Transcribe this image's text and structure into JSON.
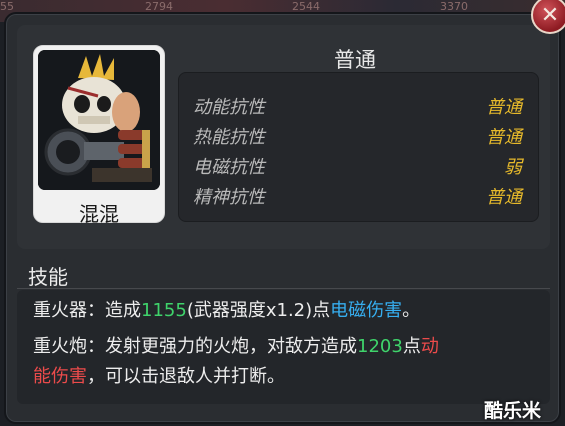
{
  "top_strip": {
    "numbers": [
      "55",
      "2794",
      "2544",
      "3370"
    ]
  },
  "close_button": {
    "label": "✕"
  },
  "character": {
    "name": "混混",
    "portrait_icon": "punk-skull-mask-character"
  },
  "resistance": {
    "type_title": "普通",
    "rows": [
      {
        "label": "动能抗性",
        "value": "普通"
      },
      {
        "label": "热能抗性",
        "value": "普通"
      },
      {
        "label": "电磁抗性",
        "value": "弱"
      },
      {
        "label": "精神抗性",
        "value": "普通"
      }
    ]
  },
  "skills": {
    "title": "技能",
    "items": [
      {
        "name": "重火器",
        "sep": "：",
        "text1": "造成",
        "number": "1155",
        "text2": "(武器强度x1.2)点",
        "damage": "电磁伤害",
        "text3": "。"
      },
      {
        "name": "重火炮",
        "sep": "：",
        "text1": "发射更强力的火炮，对敌方造成",
        "number": "1203",
        "text2": "点",
        "damage_line1": "动",
        "damage_line2": "能伤害",
        "text3": "，可以击退敌人并打断。"
      }
    ]
  },
  "watermark": "酷乐米",
  "colors": {
    "value_gold": "#e6b92b",
    "number_green": "#3fd36b",
    "electro_blue": "#36aef0",
    "kinetic_red": "#ec4b4b"
  }
}
